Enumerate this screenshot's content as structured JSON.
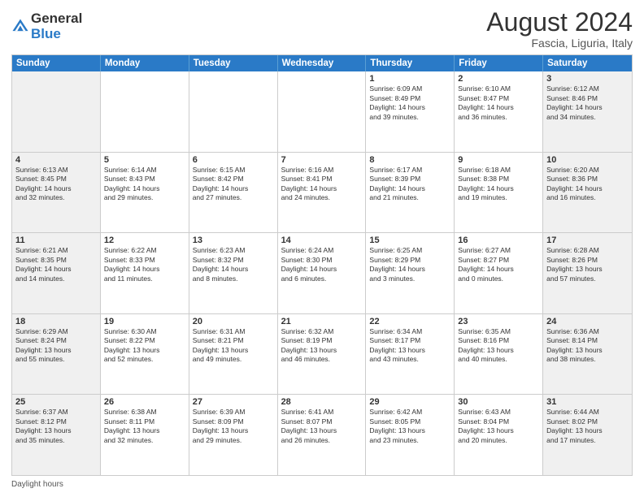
{
  "logo": {
    "general": "General",
    "blue": "Blue"
  },
  "title": "August 2024",
  "subtitle": "Fascia, Liguria, Italy",
  "weekdays": [
    "Sunday",
    "Monday",
    "Tuesday",
    "Wednesday",
    "Thursday",
    "Friday",
    "Saturday"
  ],
  "weeks": [
    [
      {
        "day": "",
        "info": ""
      },
      {
        "day": "",
        "info": ""
      },
      {
        "day": "",
        "info": ""
      },
      {
        "day": "",
        "info": ""
      },
      {
        "day": "1",
        "info": "Sunrise: 6:09 AM\nSunset: 8:49 PM\nDaylight: 14 hours\nand 39 minutes."
      },
      {
        "day": "2",
        "info": "Sunrise: 6:10 AM\nSunset: 8:47 PM\nDaylight: 14 hours\nand 36 minutes."
      },
      {
        "day": "3",
        "info": "Sunrise: 6:12 AM\nSunset: 8:46 PM\nDaylight: 14 hours\nand 34 minutes."
      }
    ],
    [
      {
        "day": "4",
        "info": "Sunrise: 6:13 AM\nSunset: 8:45 PM\nDaylight: 14 hours\nand 32 minutes."
      },
      {
        "day": "5",
        "info": "Sunrise: 6:14 AM\nSunset: 8:43 PM\nDaylight: 14 hours\nand 29 minutes."
      },
      {
        "day": "6",
        "info": "Sunrise: 6:15 AM\nSunset: 8:42 PM\nDaylight: 14 hours\nand 27 minutes."
      },
      {
        "day": "7",
        "info": "Sunrise: 6:16 AM\nSunset: 8:41 PM\nDaylight: 14 hours\nand 24 minutes."
      },
      {
        "day": "8",
        "info": "Sunrise: 6:17 AM\nSunset: 8:39 PM\nDaylight: 14 hours\nand 21 minutes."
      },
      {
        "day": "9",
        "info": "Sunrise: 6:18 AM\nSunset: 8:38 PM\nDaylight: 14 hours\nand 19 minutes."
      },
      {
        "day": "10",
        "info": "Sunrise: 6:20 AM\nSunset: 8:36 PM\nDaylight: 14 hours\nand 16 minutes."
      }
    ],
    [
      {
        "day": "11",
        "info": "Sunrise: 6:21 AM\nSunset: 8:35 PM\nDaylight: 14 hours\nand 14 minutes."
      },
      {
        "day": "12",
        "info": "Sunrise: 6:22 AM\nSunset: 8:33 PM\nDaylight: 14 hours\nand 11 minutes."
      },
      {
        "day": "13",
        "info": "Sunrise: 6:23 AM\nSunset: 8:32 PM\nDaylight: 14 hours\nand 8 minutes."
      },
      {
        "day": "14",
        "info": "Sunrise: 6:24 AM\nSunset: 8:30 PM\nDaylight: 14 hours\nand 6 minutes."
      },
      {
        "day": "15",
        "info": "Sunrise: 6:25 AM\nSunset: 8:29 PM\nDaylight: 14 hours\nand 3 minutes."
      },
      {
        "day": "16",
        "info": "Sunrise: 6:27 AM\nSunset: 8:27 PM\nDaylight: 14 hours\nand 0 minutes."
      },
      {
        "day": "17",
        "info": "Sunrise: 6:28 AM\nSunset: 8:26 PM\nDaylight: 13 hours\nand 57 minutes."
      }
    ],
    [
      {
        "day": "18",
        "info": "Sunrise: 6:29 AM\nSunset: 8:24 PM\nDaylight: 13 hours\nand 55 minutes."
      },
      {
        "day": "19",
        "info": "Sunrise: 6:30 AM\nSunset: 8:22 PM\nDaylight: 13 hours\nand 52 minutes."
      },
      {
        "day": "20",
        "info": "Sunrise: 6:31 AM\nSunset: 8:21 PM\nDaylight: 13 hours\nand 49 minutes."
      },
      {
        "day": "21",
        "info": "Sunrise: 6:32 AM\nSunset: 8:19 PM\nDaylight: 13 hours\nand 46 minutes."
      },
      {
        "day": "22",
        "info": "Sunrise: 6:34 AM\nSunset: 8:17 PM\nDaylight: 13 hours\nand 43 minutes."
      },
      {
        "day": "23",
        "info": "Sunrise: 6:35 AM\nSunset: 8:16 PM\nDaylight: 13 hours\nand 40 minutes."
      },
      {
        "day": "24",
        "info": "Sunrise: 6:36 AM\nSunset: 8:14 PM\nDaylight: 13 hours\nand 38 minutes."
      }
    ],
    [
      {
        "day": "25",
        "info": "Sunrise: 6:37 AM\nSunset: 8:12 PM\nDaylight: 13 hours\nand 35 minutes."
      },
      {
        "day": "26",
        "info": "Sunrise: 6:38 AM\nSunset: 8:11 PM\nDaylight: 13 hours\nand 32 minutes."
      },
      {
        "day": "27",
        "info": "Sunrise: 6:39 AM\nSunset: 8:09 PM\nDaylight: 13 hours\nand 29 minutes."
      },
      {
        "day": "28",
        "info": "Sunrise: 6:41 AM\nSunset: 8:07 PM\nDaylight: 13 hours\nand 26 minutes."
      },
      {
        "day": "29",
        "info": "Sunrise: 6:42 AM\nSunset: 8:05 PM\nDaylight: 13 hours\nand 23 minutes."
      },
      {
        "day": "30",
        "info": "Sunrise: 6:43 AM\nSunset: 8:04 PM\nDaylight: 13 hours\nand 20 minutes."
      },
      {
        "day": "31",
        "info": "Sunrise: 6:44 AM\nSunset: 8:02 PM\nDaylight: 13 hours\nand 17 minutes."
      }
    ]
  ],
  "footer": "Daylight hours"
}
